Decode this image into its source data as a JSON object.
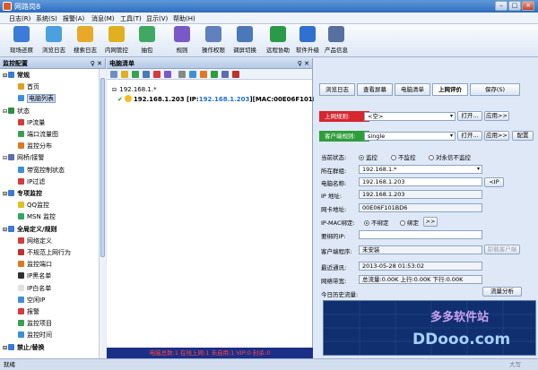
{
  "window": {
    "title": "网路岗8",
    "minimize": "–",
    "maximize": "□",
    "close": "×"
  },
  "menu": [
    "日志(R)",
    "系统(S)",
    "报警(A)",
    "消息(M)",
    "工具(T)",
    "显示(V)",
    "帮助(H)"
  ],
  "toolbar": [
    {
      "label": "现场还原",
      "color": "#3d7bd9"
    },
    {
      "label": "浏览日志",
      "color": "#4aa0e0"
    },
    {
      "label": "搜索日志",
      "color": "#e8a82a"
    },
    {
      "label": "内网管控",
      "color": "#e0b020"
    },
    {
      "label": "抽包",
      "color": "#40a860"
    },
    {
      "label": "规则",
      "color": "#7a58c8"
    },
    {
      "label": "操作权限",
      "color": "#6080c0"
    },
    {
      "label": "调屏切换",
      "color": "#4a78b8"
    },
    {
      "label": "远程协助",
      "color": "#2a9a48"
    },
    {
      "label": "软件升级",
      "color": "#2f70d0"
    },
    {
      "label": "产品信息",
      "color": "#5870a0"
    }
  ],
  "left_panel": {
    "title": "监控配置",
    "pin": "♀ ✕",
    "tree": [
      {
        "label": "常规",
        "level": 0,
        "group": true,
        "icon": "#3a7bd5"
      },
      {
        "label": "首页",
        "level": 1,
        "icon": "#e0a020"
      },
      {
        "label": "电脑列表",
        "level": 1,
        "selected": true,
        "icon": "#3d8fd8"
      },
      {
        "label": "状态",
        "level": 0,
        "group": false,
        "icon": "#2e8f40"
      },
      {
        "label": "IP流量",
        "level": 1,
        "icon": "#d63a3a"
      },
      {
        "label": "端口流量图",
        "level": 1,
        "icon": "#3aa050"
      },
      {
        "label": "监控分布",
        "level": 1,
        "icon": "#e07820"
      },
      {
        "label": "网桥/接警",
        "level": 0,
        "group": false,
        "icon": "#5a6fb0"
      },
      {
        "label": "带宽控制状态",
        "level": 1,
        "icon": "#3d8fd8"
      },
      {
        "label": "IP过滤",
        "level": 1,
        "icon": "#d63a3a"
      },
      {
        "label": "专项监控",
        "level": 0,
        "group": true,
        "icon": "#3a7bd5"
      },
      {
        "label": "QQ监控",
        "level": 1,
        "icon": "#e0c020"
      },
      {
        "label": "MSN 监控",
        "level": 1,
        "icon": "#2ea860"
      },
      {
        "label": "全局定义/规则",
        "level": 0,
        "group": true,
        "icon": "#3a7bd5"
      },
      {
        "label": "网络定义",
        "level": 1,
        "icon": "#d63a3a"
      },
      {
        "label": "不规范上网行为",
        "level": 1,
        "icon": "#c03030"
      },
      {
        "label": "监控端口",
        "level": 1,
        "icon": "#e07820"
      },
      {
        "label": "IP黑名单",
        "level": 1,
        "icon": "#303030"
      },
      {
        "label": "IP白名单",
        "level": 1,
        "icon": "#e0e0e0"
      },
      {
        "label": "空闲IP",
        "level": 1,
        "icon": "#3d8fd8"
      },
      {
        "label": "报警",
        "level": 1,
        "icon": "#d63a3a"
      },
      {
        "label": "监控项目",
        "level": 1,
        "icon": "#3aa050"
      },
      {
        "label": "监控时间",
        "level": 1,
        "icon": "#3d8fd8"
      },
      {
        "label": "禁止/替换",
        "level": 0,
        "group": true,
        "icon": "#3a7bd5"
      }
    ]
  },
  "mid_panel": {
    "title": "电脑清单",
    "pin": "♀ ✕",
    "root": "192.168.1.*",
    "computer": "192.168.1.203",
    "computer_ip_prefix": "[IP:",
    "computer_ip": "192.168.1.203",
    "computer_mac": "][MAC:00E06F101BD6]",
    "status_line": "电脑总数:1  在线上网:1  未启用:1  VIP:0  封杀:0"
  },
  "right_panel": {
    "tabs": [
      "浏览日志",
      "查看屏幕",
      "电脑清单",
      "上网评价",
      "保存(S)"
    ],
    "rule_online_label": "上网规则:",
    "rule_online_value": "<空>",
    "rule_client_label": "客户端规则:",
    "rule_client_value": "single",
    "open_btn": "打开...",
    "apply_btn": "应用>>",
    "config_btn": "配置",
    "current_status_label": "当前状态:",
    "status_options": [
      "监控",
      "不监控",
      "对永信不监控"
    ],
    "group_label": "所在群组:",
    "group_value": "192.168.1.*",
    "pc_name_label": "电脑名称:",
    "pc_name_value": "192.168.1.203",
    "ip_btn": "<IP",
    "ip_label": "IP 地址:",
    "ip_value": "192.168.1.203",
    "nic_label": "网卡地址:",
    "nic_value": "00E06F101BD6",
    "bind_label": "IP-MAC绑定:",
    "bind_options": [
      "不绑定",
      "绑定"
    ],
    "bind_more": ">>",
    "req_ip_label": "要绑的IP:",
    "client_label": "客户端程序:",
    "client_value": "未安装",
    "uninstall_btn": "卸载客户端",
    "last_comm_label": "最近通讯:",
    "last_comm_value": "2013-05-28 01:53:02",
    "bandwidth_label": "网络带宽:",
    "bandwidth_value": "总流量:0.00K 上行:0.00K 下行:0.00K",
    "today_label": "今日历史流量:",
    "flow_btn": "流量分析"
  },
  "watermark": {
    "text1": "多多软件站",
    "text2": "DDooo.com"
  },
  "statusbar": {
    "left": "就绪",
    "right": "大写"
  }
}
